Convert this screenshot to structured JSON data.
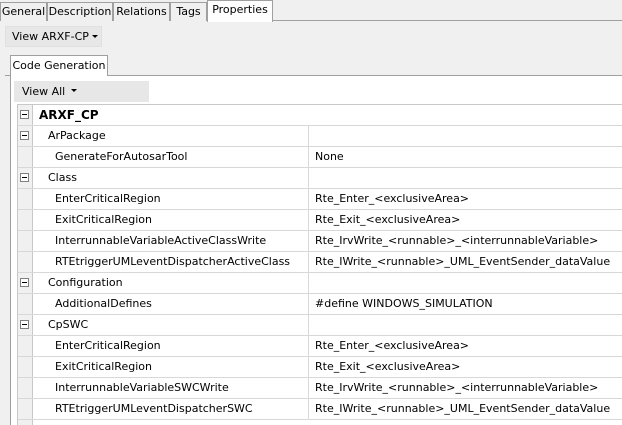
{
  "top_tabs": [
    "General",
    "Description",
    "Relations",
    "Tags",
    "Properties"
  ],
  "view_dropdown": {
    "label": "View ARXF-CP"
  },
  "inner_tab": {
    "label": "Code Generation"
  },
  "view_all": {
    "label": "View All"
  },
  "grid": {
    "rows": [
      {
        "label": "ARXF_CP",
        "value": "",
        "kind": "root"
      },
      {
        "label": "ArPackage",
        "value": "",
        "kind": "group"
      },
      {
        "label": "GenerateForAutosarTool",
        "value": "None",
        "kind": "prop"
      },
      {
        "label": "Class",
        "value": "",
        "kind": "group"
      },
      {
        "label": "EnterCriticalRegion",
        "value": "Rte_Enter_<exclusiveArea>",
        "kind": "prop"
      },
      {
        "label": "ExitCriticalRegion",
        "value": "Rte_Exit_<exclusiveArea>",
        "kind": "prop"
      },
      {
        "label": "InterrunnableVariableActiveClassWrite",
        "value": "Rte_IrvWrite_<runnable>_<interrunnableVariable>",
        "kind": "prop"
      },
      {
        "label": "RTEtriggerUMLeventDispatcherActiveClass",
        "value": "Rte_IWrite_<runnable>_UML_EventSender_dataValue",
        "kind": "prop"
      },
      {
        "label": "Configuration",
        "value": "",
        "kind": "group"
      },
      {
        "label": "AdditionalDefines",
        "value": "#define WINDOWS_SIMULATION",
        "kind": "prop"
      },
      {
        "label": "CpSWC",
        "value": "",
        "kind": "group"
      },
      {
        "label": "EnterCriticalRegion",
        "value": "Rte_Enter_<exclusiveArea>",
        "kind": "prop"
      },
      {
        "label": "ExitCriticalRegion",
        "value": "Rte_Exit_<exclusiveArea>",
        "kind": "prop"
      },
      {
        "label": "InterrunnableVariableSWCWrite",
        "value": "Rte_IrvWrite_<runnable>_<interrunnableVariable>",
        "kind": "prop"
      },
      {
        "label": "RTEtriggerUMLeventDispatcherSWC",
        "value": "Rte_IWrite_<runnable>_UML_EventSender_dataValue",
        "kind": "prop"
      }
    ]
  }
}
